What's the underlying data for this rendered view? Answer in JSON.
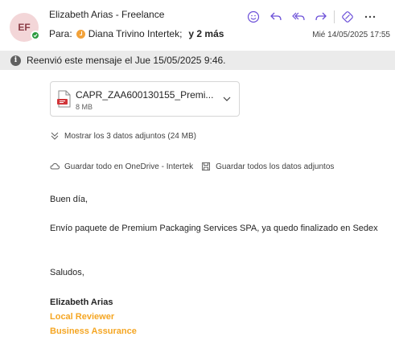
{
  "header": {
    "avatar_initials": "EF",
    "sender": "Elizabeth Arias - Freelance",
    "to_prefix": "Para:",
    "to_name": "Diana Trivino Intertek;",
    "to_more": "y 2 más",
    "date": "Mié 14/05/2025 17:55",
    "actions": [
      "smiley-icon",
      "reply-icon",
      "reply-all-icon",
      "forward-icon",
      "loop-icon",
      "more-icon"
    ]
  },
  "banner": {
    "text": "Reenvió este mensaje el Jue 15/05/2025 9:46."
  },
  "attachment": {
    "name": "CAPR_ZAA600130155_Premi...",
    "size": "8 MB",
    "icon": "pdf-file-icon"
  },
  "show_all": {
    "label": "Mostrar los 3 datos adjuntos (24 MB)"
  },
  "save": {
    "onedrive_label": "Guardar todo en OneDrive - Intertek",
    "all_label": "Guardar todos los datos adjuntos"
  },
  "message": {
    "greeting": "Buen día,",
    "paragraph": "Envío paquete de Premium Packaging Services SPA, ya quedo finalizado en Sedex",
    "closing": "Saludos,"
  },
  "signature": {
    "name": "Elizabeth Arias",
    "role": "Local Reviewer",
    "department": "Business Assurance"
  },
  "colors": {
    "presence": "#2e9b40",
    "accent": "#6b4fd8",
    "signature_orange": "#f5a623",
    "banner_bg": "#ebebeb"
  }
}
